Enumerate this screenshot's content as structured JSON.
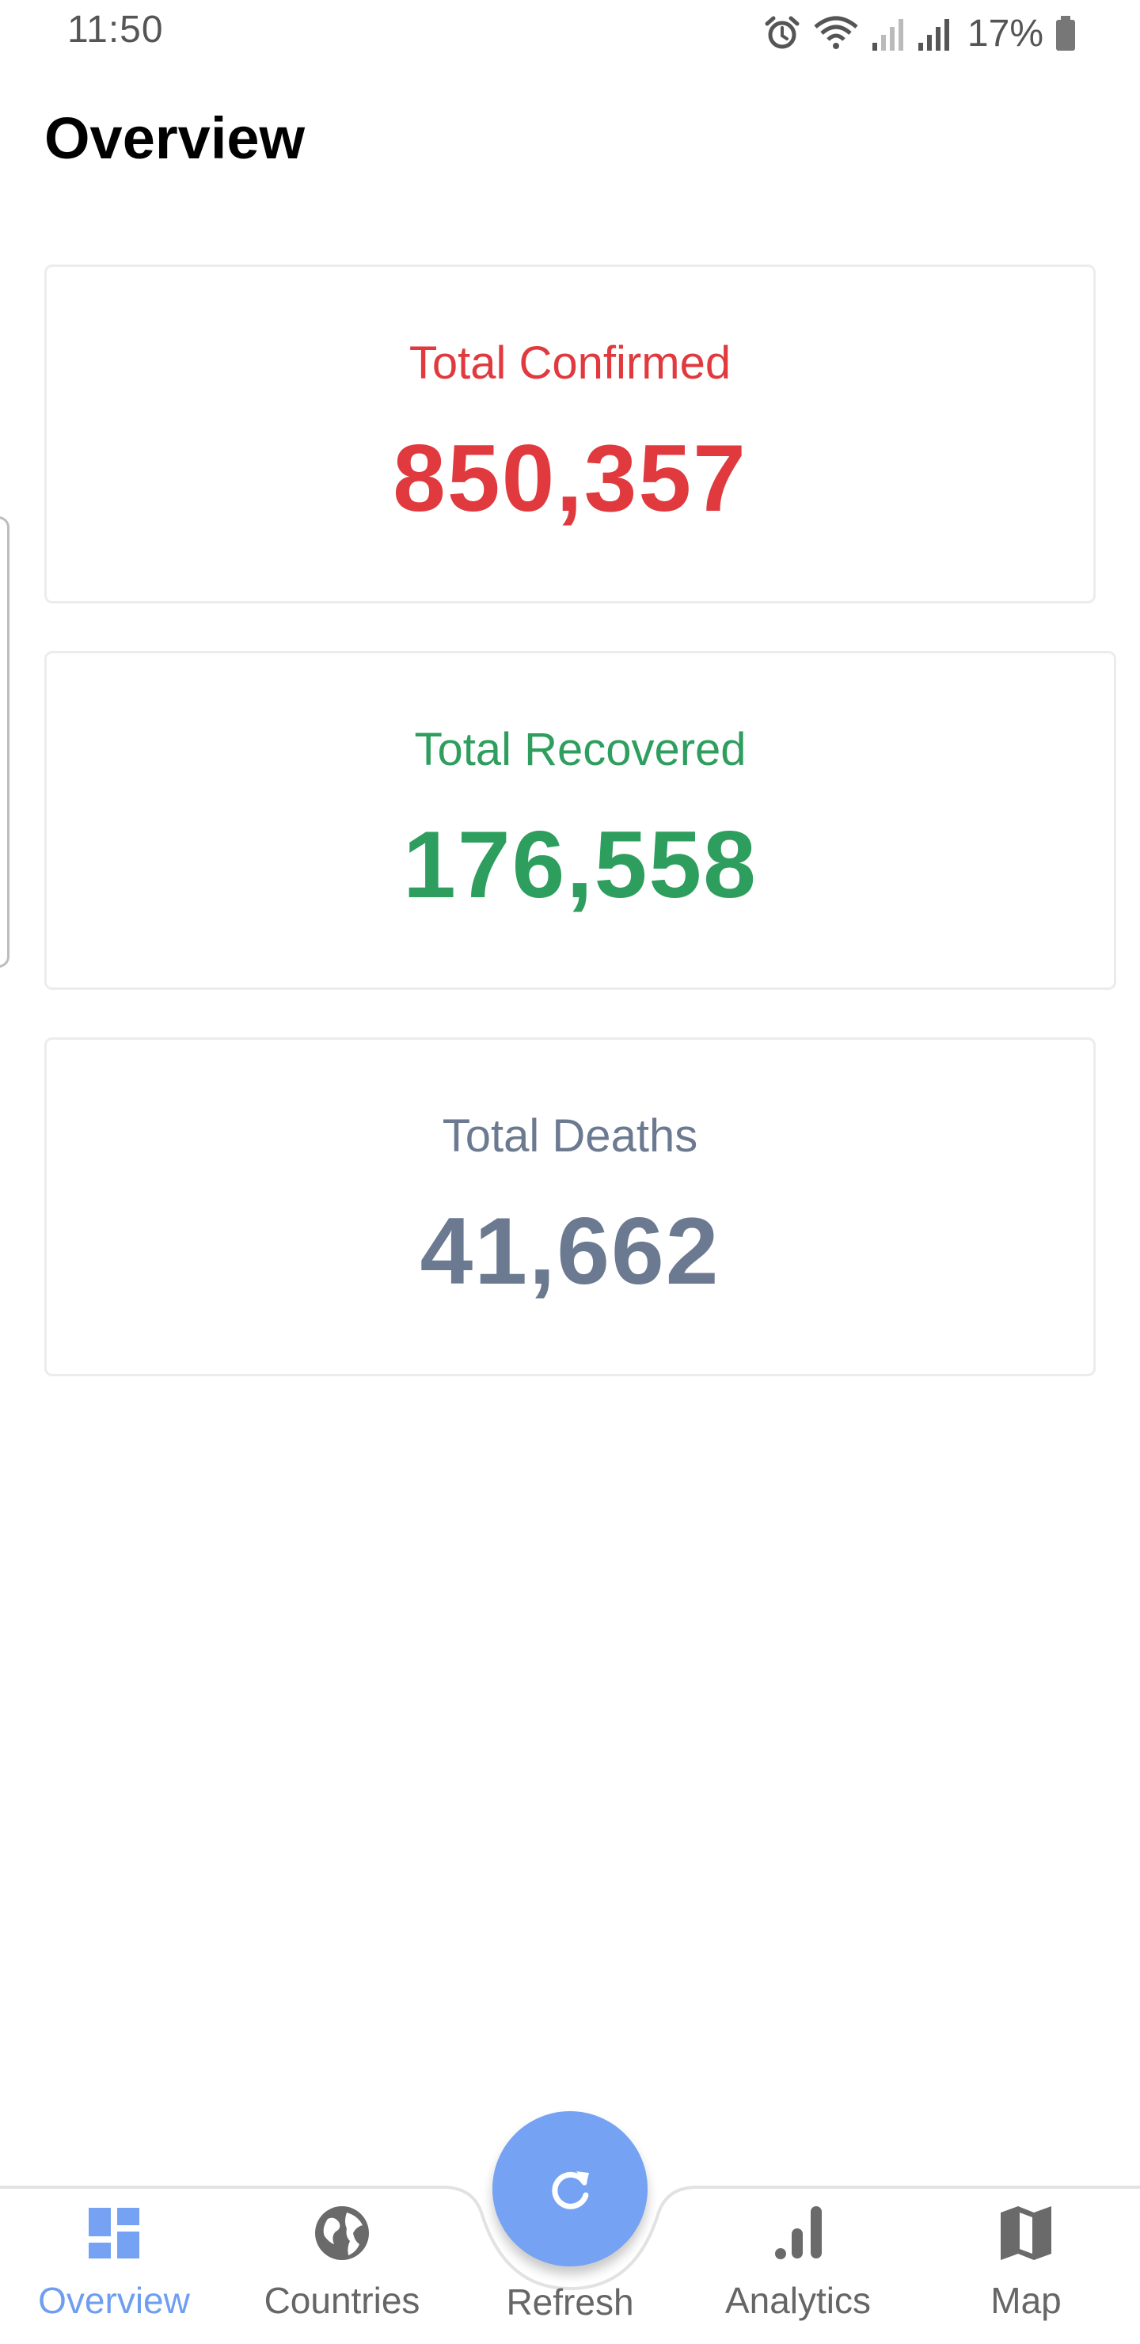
{
  "status_bar": {
    "time": "11:50",
    "battery": "17%",
    "icons": [
      "alarm-icon",
      "wifi-icon",
      "signal-icon",
      "signal-icon",
      "battery-icon"
    ]
  },
  "header": {
    "title": "Overview"
  },
  "stats": {
    "confirmed": {
      "label": "Total Confirmed",
      "value": "850,357",
      "color": "#e0393e"
    },
    "recovered": {
      "label": "Total Recovered",
      "value": "176,558",
      "color": "#2e9e5e"
    },
    "deaths": {
      "label": "Total Deaths",
      "value": "41,662",
      "color": "#6b7a90"
    }
  },
  "bottom_nav": {
    "accent_color": "#6f9ef0",
    "items": [
      {
        "label": "Overview",
        "icon": "dashboard-icon",
        "active": true
      },
      {
        "label": "Countries",
        "icon": "globe-icon",
        "active": false
      },
      {
        "label": "Refresh",
        "icon": "refresh-icon",
        "active": false
      },
      {
        "label": "Analytics",
        "icon": "bar-chart-icon",
        "active": false
      },
      {
        "label": "Map",
        "icon": "map-icon",
        "active": false
      }
    ]
  }
}
